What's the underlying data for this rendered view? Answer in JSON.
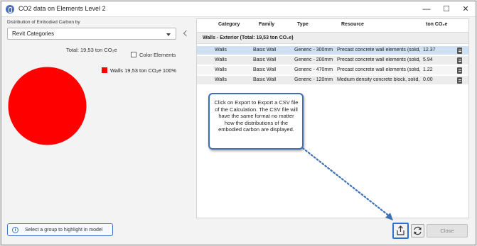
{
  "window": {
    "title": "CO2 data on Elements Level 2",
    "minimize_glyph": "—",
    "maximize_glyph": "☐",
    "close_glyph": "✕"
  },
  "left_panel": {
    "distribution_label": "Distribution of Embodied Carbon by",
    "dropdown_value": "Revit Categories",
    "total_label": "Total: 19,53 ton CO₂e",
    "color_elements_label": "Color Elements",
    "color_elements_checked": false,
    "legend": [
      {
        "label": "Walls 19,53 ton CO₂e 100%",
        "color": "#ff0000"
      }
    ],
    "hint_text": "Select a group to highlight in model"
  },
  "chart_data": {
    "type": "pie",
    "title": "Total: 19,53 ton CO₂e",
    "categories": [
      "Walls"
    ],
    "values": [
      19.53
    ],
    "percentages": [
      100
    ],
    "colors": [
      "#ff0000"
    ],
    "legend_position": "right"
  },
  "table": {
    "columns": [
      "Category",
      "Family",
      "Type",
      "Resource",
      "ton CO₂e"
    ],
    "group_label": "Walls - Exterior (Total: 19,53 ton CO₂e)",
    "rows": [
      {
        "category": "Walls",
        "family": "Basic Wall",
        "type": "Generic - 300mm",
        "resource": "Precast concrete wall elements (solid,",
        "value": "12.37",
        "selected": true
      },
      {
        "category": "Walls",
        "family": "Basic Wall",
        "type": "Generic - 200mm",
        "resource": "Precast concrete wall elements (solid,",
        "value": "5.94",
        "selected": false
      },
      {
        "category": "Walls",
        "family": "Basic Wall",
        "type": "Generic - 470mm",
        "resource": "Precast concrete wall elements (solid,",
        "value": "1.22",
        "selected": false
      },
      {
        "category": "Walls",
        "family": "Basic Wall",
        "type": "Generic - 120mm",
        "resource": "Medium density concrete block, solid,",
        "value": "0.00",
        "selected": false
      }
    ]
  },
  "callout": {
    "text": "Click on Export to Export a CSV file of the Calculation. The CSV file will have the same format no matter how the distributions of the embodied carbon are displayed.",
    "border_color": "#3d6fb5"
  },
  "buttons": {
    "export_icon": "export-icon",
    "refresh_icon": "refresh-icon",
    "close_label": "Close"
  }
}
